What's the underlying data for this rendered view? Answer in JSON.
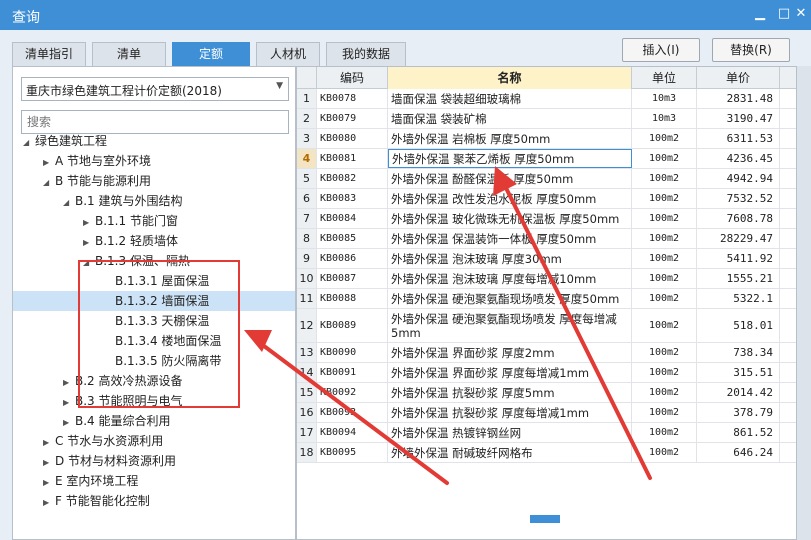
{
  "window": {
    "title": "查询"
  },
  "tabs": [
    {
      "label": "清单指引"
    },
    {
      "label": "清单"
    },
    {
      "label": "定额",
      "active": true
    },
    {
      "label": "人材机"
    },
    {
      "label": "我的数据"
    }
  ],
  "toolbar": {
    "insert_label": "插入(I)",
    "replace_label": "替换(R)"
  },
  "left": {
    "dropdown_value": "重庆市绿色建筑工程计价定额(2018)",
    "search_placeholder": "搜索"
  },
  "tree": [
    {
      "label": "绿色建筑工程",
      "state": "expanded"
    },
    {
      "label": "A 节地与室外环境",
      "state": "collapsed"
    },
    {
      "label": "B 节能与能源利用",
      "state": "expanded"
    },
    {
      "label": "B.1 建筑与外围结构",
      "state": "expanded"
    },
    {
      "label": "B.1.1 节能门窗",
      "state": "collapsed"
    },
    {
      "label": "B.1.2 轻质墙体",
      "state": "collapsed"
    },
    {
      "label": "B.1.3 保温、隔热",
      "state": "expanded"
    },
    {
      "label": "B.1.3.1 屋面保温",
      "state": "leaf"
    },
    {
      "label": "B.1.3.2 墙面保温",
      "state": "leaf",
      "selected": true
    },
    {
      "label": "B.1.3.3 天棚保温",
      "state": "leaf"
    },
    {
      "label": "B.1.3.4 楼地面保温",
      "state": "leaf"
    },
    {
      "label": "B.1.3.5 防火隔离带",
      "state": "leaf"
    },
    {
      "label": "B.2 高效冷热源设备",
      "state": "collapsed"
    },
    {
      "label": "B.3 节能照明与电气",
      "state": "collapsed"
    },
    {
      "label": "B.4 能量综合利用",
      "state": "collapsed"
    },
    {
      "label": "C 节水与水资源利用",
      "state": "collapsed"
    },
    {
      "label": "D 节材与材料资源利用",
      "state": "collapsed"
    },
    {
      "label": "E 室内环境工程",
      "state": "collapsed"
    },
    {
      "label": "F 节能智能化控制",
      "state": "collapsed"
    }
  ],
  "table": {
    "headers": [
      "编码",
      "名称",
      "单位",
      "单价"
    ],
    "rows": [
      {
        "n": "1",
        "code": "KB0078",
        "name": "墙面保温 袋装超细玻璃棉",
        "unit": "10m3",
        "price": "2831.48"
      },
      {
        "n": "2",
        "code": "KB0079",
        "name": "墙面保温 袋装矿棉",
        "unit": "10m3",
        "price": "3190.47"
      },
      {
        "n": "3",
        "code": "KB0080",
        "name": "外墙外保温 岩棉板 厚度50mm",
        "unit": "100m2",
        "price": "6311.53"
      },
      {
        "n": "4",
        "code": "KB0081",
        "name": "外墙外保温 聚苯乙烯板 厚度50mm",
        "unit": "100m2",
        "price": "4236.45"
      },
      {
        "n": "5",
        "code": "KB0082",
        "name": "外墙外保温 酚醛保温板 厚度50mm",
        "unit": "100m2",
        "price": "4942.94"
      },
      {
        "n": "6",
        "code": "KB0083",
        "name": "外墙外保温 改性发泡水泥板 厚度50mm",
        "unit": "100m2",
        "price": "7532.52"
      },
      {
        "n": "7",
        "code": "KB0084",
        "name": "外墙外保温 玻化微珠无机保温板 厚度50mm",
        "unit": "100m2",
        "price": "7608.78"
      },
      {
        "n": "8",
        "code": "KB0085",
        "name": "外墙外保温 保温装饰一体板 厚度50mm",
        "unit": "100m2",
        "price": "28229.47"
      },
      {
        "n": "9",
        "code": "KB0086",
        "name": "外墙外保温 泡沫玻璃 厚度30mm",
        "unit": "100m2",
        "price": "5411.92"
      },
      {
        "n": "10",
        "code": "KB0087",
        "name": "外墙外保温 泡沫玻璃 厚度每增减10mm",
        "unit": "100m2",
        "price": "1555.21"
      },
      {
        "n": "11",
        "code": "KB0088",
        "name": "外墙外保温 硬泡聚氨酯现场喷发 厚度50mm",
        "unit": "100m2",
        "price": "5322.1"
      },
      {
        "n": "12",
        "code": "KB0089",
        "name": "外墙外保温 硬泡聚氨酯现场喷发 厚度每增减5mm",
        "unit": "100m2",
        "price": "518.01"
      },
      {
        "n": "13",
        "code": "KB0090",
        "name": "外墙外保温 界面砂浆 厚度2mm",
        "unit": "100m2",
        "price": "738.34"
      },
      {
        "n": "14",
        "code": "KB0091",
        "name": "外墙外保温 界面砂浆 厚度每增减1mm",
        "unit": "100m2",
        "price": "315.51"
      },
      {
        "n": "15",
        "code": "KB0092",
        "name": "外墙外保温 抗裂砂浆 厚度5mm",
        "unit": "100m2",
        "price": "2014.42"
      },
      {
        "n": "16",
        "code": "KB0093",
        "name": "外墙外保温 抗裂砂浆 厚度每增减1mm",
        "unit": "100m2",
        "price": "378.79"
      },
      {
        "n": "17",
        "code": "KB0094",
        "name": "外墙外保温 热镀锌钢丝网",
        "unit": "100m2",
        "price": "861.52"
      },
      {
        "n": "18",
        "code": "KB0095",
        "name": "外墙外保温 耐碱玻纤网格布",
        "unit": "100m2",
        "price": "646.24"
      }
    ]
  },
  "colors": {
    "accent": "#3f8fd6",
    "annotation": "#e23a34"
  },
  "icons": [
    "minimize-icon",
    "close-icon",
    "dropdown-arrow-icon",
    "expand-triangle-icon",
    "collapse-triangle-icon"
  ]
}
